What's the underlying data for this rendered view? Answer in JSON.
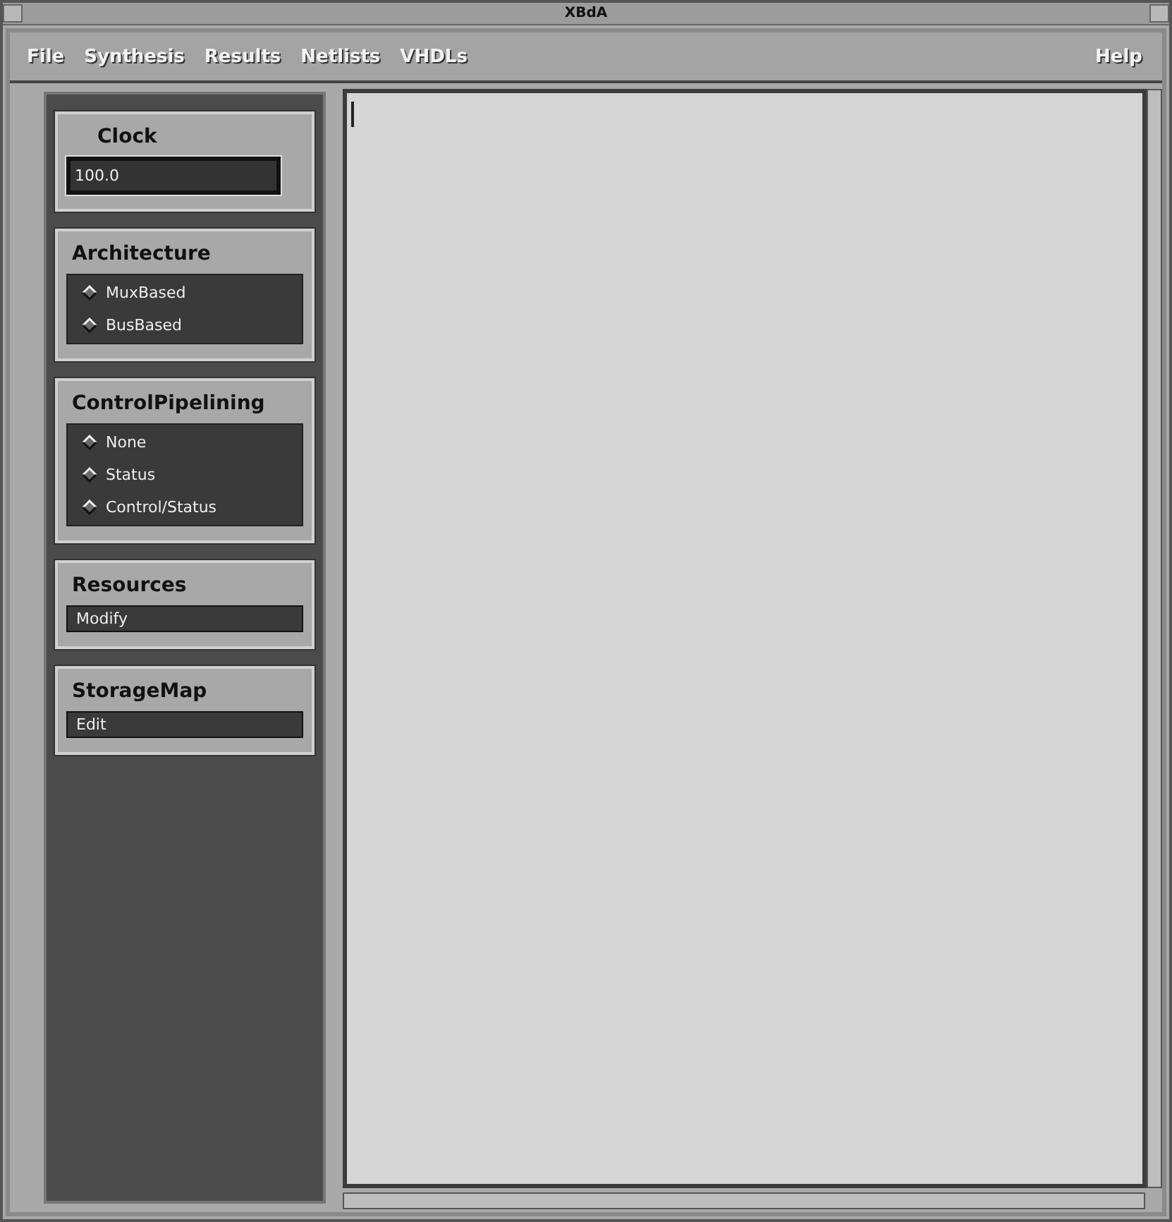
{
  "window": {
    "title": "XBdA"
  },
  "menubar": {
    "items": [
      {
        "label": "File"
      },
      {
        "label": "Synthesis"
      },
      {
        "label": "Results"
      },
      {
        "label": "Netlists"
      },
      {
        "label": "VHDLs"
      }
    ],
    "help": {
      "label": "Help"
    }
  },
  "panels": [
    {
      "kind": "field",
      "title": "Clock",
      "value": "100.0"
    },
    {
      "kind": "radio",
      "title": "Architecture",
      "options": [
        {
          "label": "MuxBased",
          "selected": false
        },
        {
          "label": "BusBased",
          "selected": false
        }
      ]
    },
    {
      "kind": "radio",
      "title": "ControlPipelining",
      "options": [
        {
          "label": "None",
          "selected": false
        },
        {
          "label": "Status",
          "selected": false
        },
        {
          "label": "Control/Status",
          "selected": false
        }
      ]
    },
    {
      "kind": "button",
      "title": "Resources",
      "button": "Modify"
    },
    {
      "kind": "button",
      "title": "StorageMap",
      "button": "Edit"
    }
  ]
}
